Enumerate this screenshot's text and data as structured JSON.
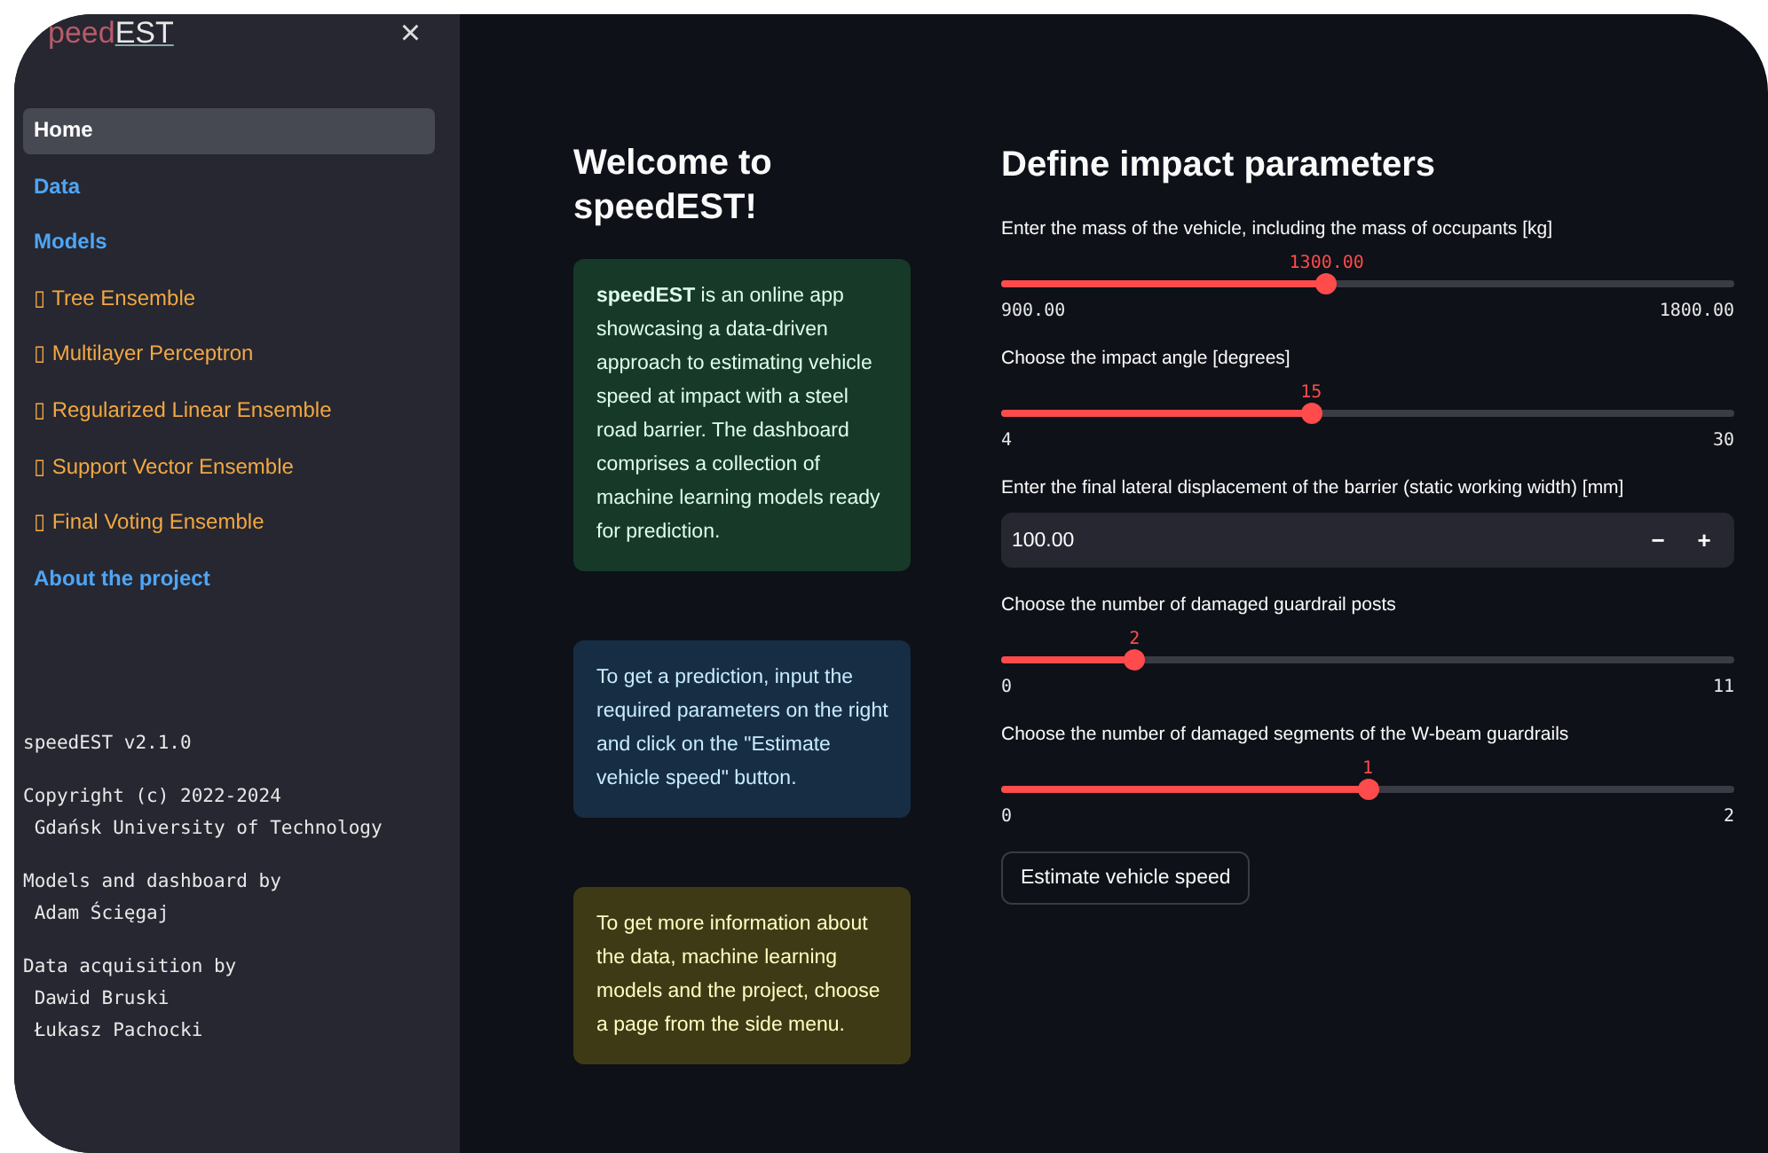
{
  "sidebar": {
    "logo": {
      "part_1": "peed",
      "part_2": "EST"
    },
    "close_button": "×",
    "nav_items": [
      {
        "label": "Home",
        "kind": "page",
        "selected": true
      },
      {
        "label": "Data",
        "kind": "page",
        "selected": false
      },
      {
        "label": "Models",
        "kind": "page",
        "selected": false
      },
      {
        "label": "▯ Tree Ensemble",
        "kind": "model",
        "selected": false
      },
      {
        "label": "▯ Multilayer Perceptron",
        "kind": "model",
        "selected": false
      },
      {
        "label": "▯ Regularized Linear Ensemble",
        "kind": "model",
        "selected": false
      },
      {
        "label": "▯ Support Vector Ensemble",
        "kind": "model",
        "selected": false
      },
      {
        "label": "▯ Final Voting Ensemble",
        "kind": "model",
        "selected": false
      },
      {
        "label": "About the project",
        "kind": "page",
        "selected": false
      }
    ],
    "footer": [
      [
        "speedEST v2.1.0"
      ],
      [
        "Copyright (c) 2022-2024",
        " Gdańsk University of Technology"
      ],
      [
        "Models and dashboard by",
        " Adam Ścięgaj"
      ],
      [
        "Data acquisition by",
        " Dawid Bruski",
        " Łukasz Pachocki"
      ]
    ]
  },
  "welcome": {
    "title": "Welcome to speedEST!",
    "cards": [
      {
        "kind": "success",
        "text": "**speedEST** is an online app showcasing a data-driven approach to estimating vehicle speed at impact with a steel road barrier. The dashboard comprises a collection of machine learning models ready for prediction."
      },
      {
        "kind": "info",
        "text": "To get a prediction, input the required parameters on the right and click on the \"Estimate vehicle speed\" button."
      },
      {
        "kind": "warning",
        "text": "To get more information about the data, machine learning models and the project, choose a page from the side menu."
      }
    ]
  },
  "parameters": {
    "title": "Define impact parameters",
    "inputs": [
      {
        "kind": "slider",
        "label": "Enter the mass of the vehicle, including the mass of occupants [kg]",
        "value": "1300.00",
        "min": "900.00",
        "max": "1800.00",
        "level": 0.444
      },
      {
        "kind": "slider",
        "label": "Choose the impact angle [degrees]",
        "value": "15",
        "min": "4",
        "max": "30",
        "level": 0.423
      },
      {
        "kind": "number",
        "label": "Enter the final lateral displacement of the barrier (static working width) [mm]",
        "value": "100.00",
        "minus": "−",
        "plus": "+"
      },
      {
        "kind": "slider",
        "label": "Choose the number of damaged guardrail posts",
        "value": "2",
        "min": "0",
        "max": "11",
        "level": 0.182
      },
      {
        "kind": "slider",
        "label": "Choose the number of damaged segments of the W-beam guardrails",
        "value": "1",
        "min": "0",
        "max": "2",
        "level": 0.5
      }
    ],
    "button": "Estimate vehicle speed"
  }
}
